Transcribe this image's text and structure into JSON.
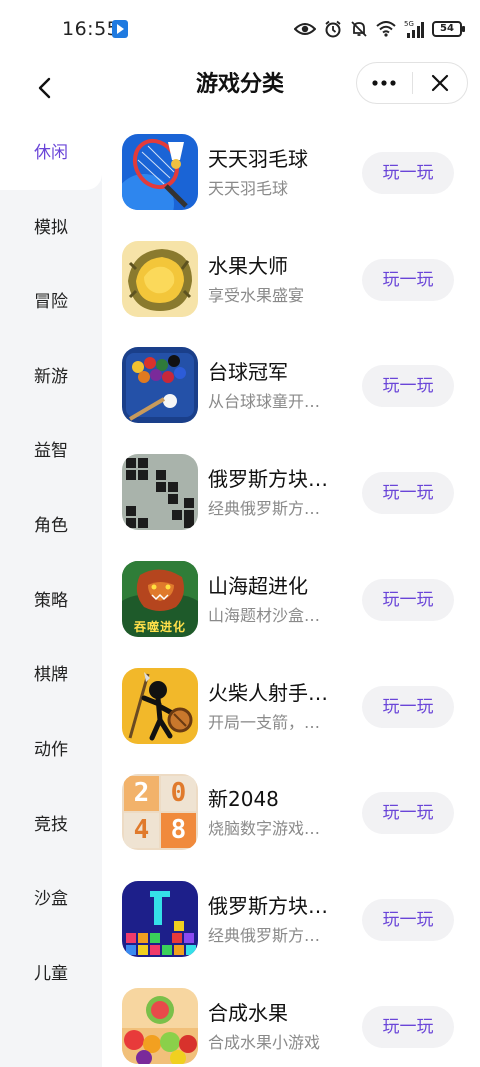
{
  "status_bar": {
    "time": "16:55",
    "battery": "54",
    "icons": [
      "app-notification-icon",
      "eye-icon",
      "alarm-icon",
      "mute-icon",
      "wifi-icon",
      "5g-signal-icon",
      "battery-icon"
    ]
  },
  "header": {
    "title": "游戏分类",
    "back_icon": "chevron-left-icon",
    "more_icon": "more-dots-icon",
    "close_icon": "close-icon"
  },
  "sidebar": {
    "items": [
      {
        "label": "休闲",
        "active": true
      },
      {
        "label": "模拟"
      },
      {
        "label": "冒险"
      },
      {
        "label": "新游"
      },
      {
        "label": "益智"
      },
      {
        "label": "角色"
      },
      {
        "label": "策略"
      },
      {
        "label": "棋牌"
      },
      {
        "label": "动作"
      },
      {
        "label": "竞技"
      },
      {
        "label": "沙盒"
      },
      {
        "label": "儿童"
      }
    ]
  },
  "games": [
    {
      "name": "天天羽毛球",
      "desc": "天天羽毛球",
      "button": "玩一玩",
      "icon": "badminton-icon"
    },
    {
      "name": "水果大师",
      "desc": "享受水果盛宴",
      "button": "玩一玩",
      "icon": "durian-icon"
    },
    {
      "name": "台球冠军",
      "desc": "从台球球童开…",
      "button": "玩一玩",
      "icon": "billiards-icon"
    },
    {
      "name": "俄罗斯方块…",
      "desc": "经典俄罗斯方…",
      "button": "玩一玩",
      "icon": "tetris-retro-icon"
    },
    {
      "name": "山海超进化",
      "desc": "山海题材沙盒…",
      "button": "玩一玩",
      "icon": "beast-icon",
      "icon_text": "吞噬进化"
    },
    {
      "name": "火柴人射手…",
      "desc": "开局一支箭，…",
      "button": "玩一玩",
      "icon": "stickman-archer-icon"
    },
    {
      "name": "新2048",
      "desc": "烧脑数字游戏…",
      "button": "玩一玩",
      "icon": "2048-icon",
      "tiles": [
        "2",
        "0",
        "4",
        "8"
      ]
    },
    {
      "name": "俄罗斯方块…",
      "desc": "经典俄罗斯方…",
      "button": "玩一玩",
      "icon": "tetris-neon-icon"
    },
    {
      "name": "合成水果",
      "desc": "合成水果小游戏",
      "button": "玩一玩",
      "icon": "fruit-merge-icon"
    }
  ],
  "colors": {
    "accent": "#6a45d8",
    "sidebar_bg": "#f4f5f7",
    "button_bg": "#f2f2f4",
    "secondary_text": "#8a8a8a"
  }
}
